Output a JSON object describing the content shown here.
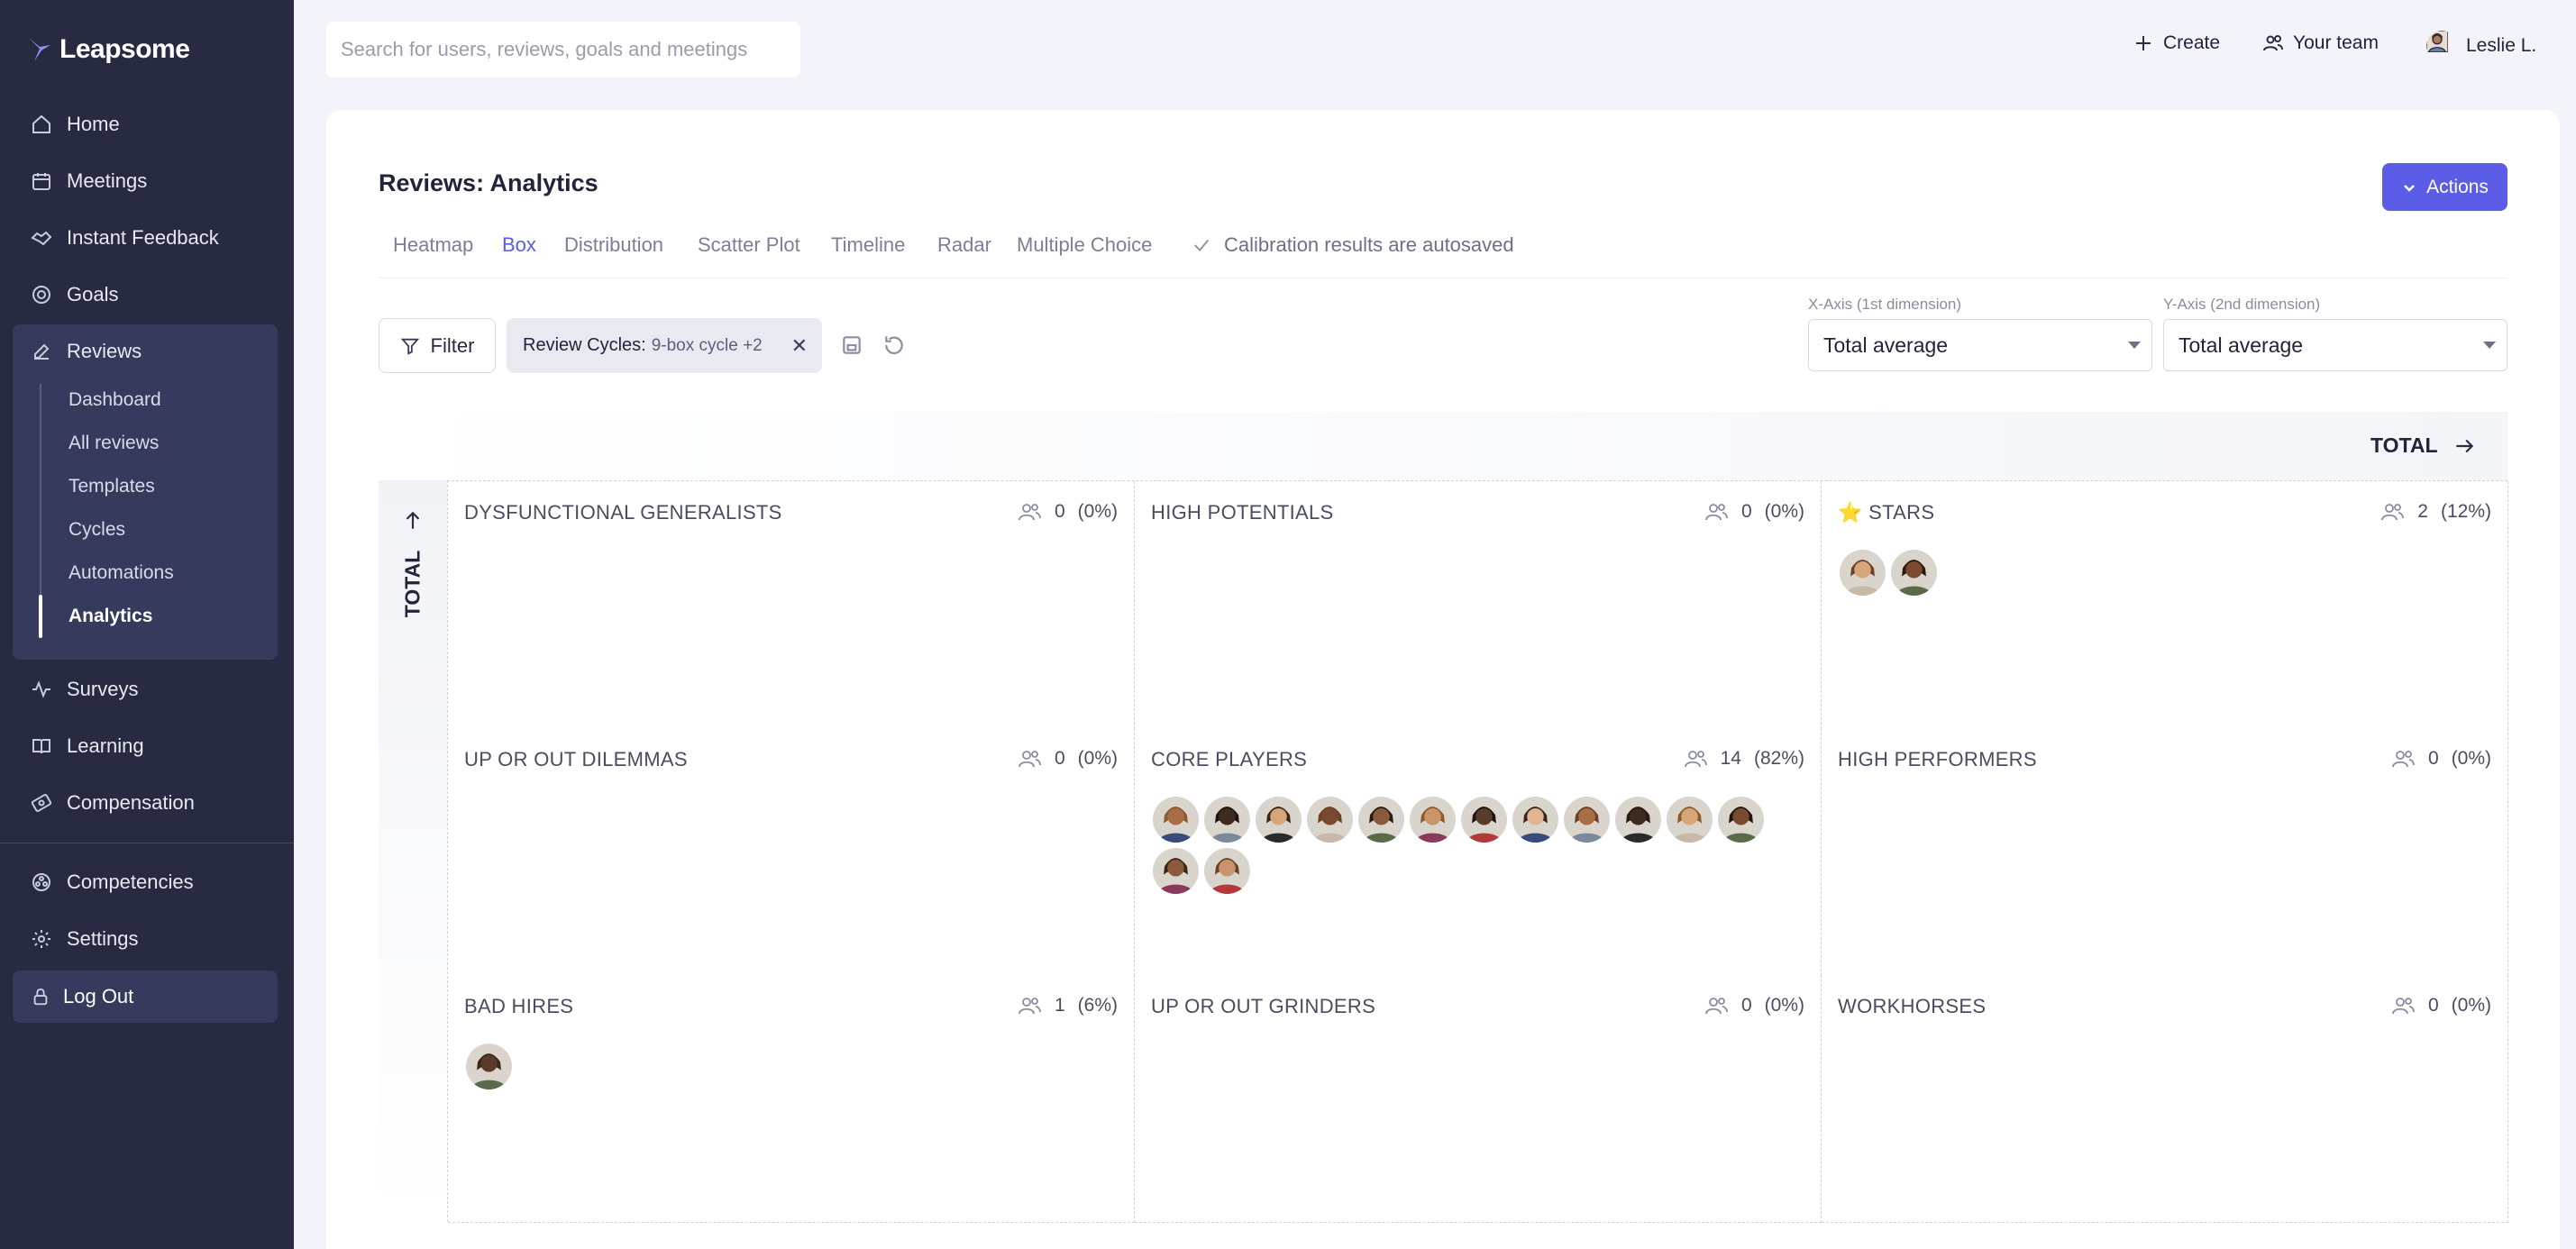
{
  "app": {
    "name": "Leapsome"
  },
  "sidebar": {
    "items": [
      {
        "label": "Home",
        "icon": "home-icon"
      },
      {
        "label": "Meetings",
        "icon": "calendar-icon"
      },
      {
        "label": "Instant Feedback",
        "icon": "handshake-icon"
      },
      {
        "label": "Goals",
        "icon": "target-icon"
      },
      {
        "label": "Reviews",
        "icon": "edit-icon"
      },
      {
        "label": "Surveys",
        "icon": "activity-icon"
      },
      {
        "label": "Learning",
        "icon": "book-icon"
      },
      {
        "label": "Compensation",
        "icon": "money-icon"
      },
      {
        "label": "Competencies",
        "icon": "competencies-icon"
      },
      {
        "label": "Settings",
        "icon": "gear-icon"
      }
    ],
    "reviews_sub": [
      "Dashboard",
      "All reviews",
      "Templates",
      "Cycles",
      "Automations",
      "Analytics"
    ],
    "active_sub": "Analytics",
    "logout": "Log Out"
  },
  "topbar": {
    "search_placeholder": "Search for users, reviews, goals and meetings",
    "create": "Create",
    "your_team": "Your team",
    "user": "Leslie L."
  },
  "page": {
    "title": "Reviews: Analytics",
    "actions": "Actions",
    "tabs": [
      "Heatmap",
      "Box",
      "Distribution",
      "Scatter Plot",
      "Timeline",
      "Radar",
      "Multiple Choice"
    ],
    "active_tab": "Box",
    "autosave": "Calibration results are autosaved"
  },
  "filters": {
    "filter_label": "Filter",
    "chip_label": "Review Cycles:",
    "chip_value": "9-box cycle +2",
    "x_axis_label": "X-Axis (1st dimension)",
    "x_axis_value": "Total average",
    "y_axis_label": "Y-Axis (2nd dimension)",
    "y_axis_value": "Total average"
  },
  "grid": {
    "x_total": "TOTAL",
    "y_total": "TOTAL",
    "cells": [
      {
        "title": "DYSFUNCTIONAL GENERALISTS",
        "count": "0",
        "pct": "(0%)",
        "people": 0
      },
      {
        "title": "HIGH POTENTIALS",
        "count": "0",
        "pct": "(0%)",
        "people": 0
      },
      {
        "title": "⭐ STARS",
        "count": "2",
        "pct": "(12%)",
        "people": 2
      },
      {
        "title": "UP OR OUT DILEMMAS",
        "count": "0",
        "pct": "(0%)",
        "people": 0
      },
      {
        "title": "CORE PLAYERS",
        "count": "14",
        "pct": "(82%)",
        "people": 14
      },
      {
        "title": "HIGH PERFORMERS",
        "count": "0",
        "pct": "(0%)",
        "people": 0
      },
      {
        "title": "BAD HIRES",
        "count": "1",
        "pct": "(6%)",
        "people": 1
      },
      {
        "title": "UP OR OUT GRINDERS",
        "count": "0",
        "pct": "(0%)",
        "people": 0
      },
      {
        "title": "WORKHORSES",
        "count": "0",
        "pct": "(0%)",
        "people": 0
      }
    ]
  },
  "colors": {
    "sidebar_bg": "#272a40",
    "accent": "#5b5de6",
    "active_group": "#363a5c"
  }
}
